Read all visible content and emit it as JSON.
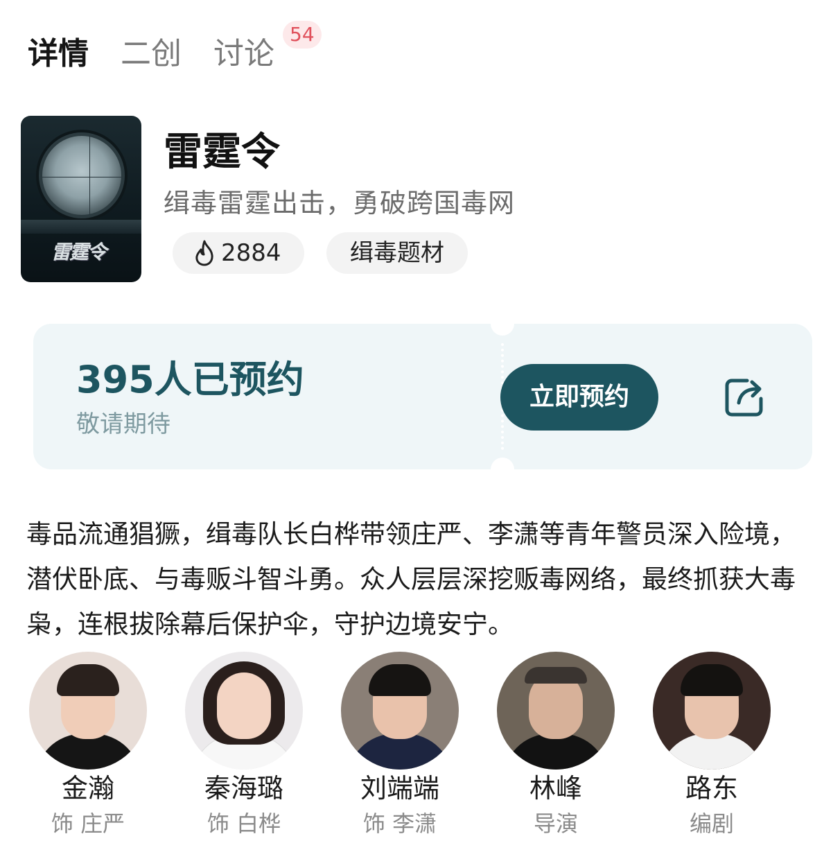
{
  "tabs": [
    {
      "label": "详情",
      "active": true
    },
    {
      "label": "二创",
      "active": false
    },
    {
      "label": "讨论",
      "active": false
    }
  ],
  "discussion_badge": "54",
  "show": {
    "title": "雷霆令",
    "subtitle": "缉毒雷霆出击，勇破跨国毒网",
    "heat_icon": "fire-icon",
    "heat": "2884",
    "tag": "缉毒题材",
    "poster_logo": "雷霆令"
  },
  "reservation": {
    "count_text": "395人已预约",
    "sub_text": "敬请期待",
    "button_label": "立即预约",
    "share_icon": "share-icon",
    "accent_color": "#1d5560"
  },
  "description": "毒品流通猖獗，缉毒队长白桦带领庄严、李潇等青年警员深入险境，潜伏卧底、与毒贩斗智斗勇。众人层层深挖贩毒网络，最终抓获大毒枭，连根拔除幕后保护伞，守护边境安宁。",
  "cast": [
    {
      "name": "金瀚",
      "role": "饰 庄严"
    },
    {
      "name": "秦海璐",
      "role": "饰 白桦"
    },
    {
      "name": "刘端端",
      "role": "饰 李潇"
    },
    {
      "name": "林峰",
      "role": "导演"
    },
    {
      "name": "路东",
      "role": "编剧"
    }
  ]
}
